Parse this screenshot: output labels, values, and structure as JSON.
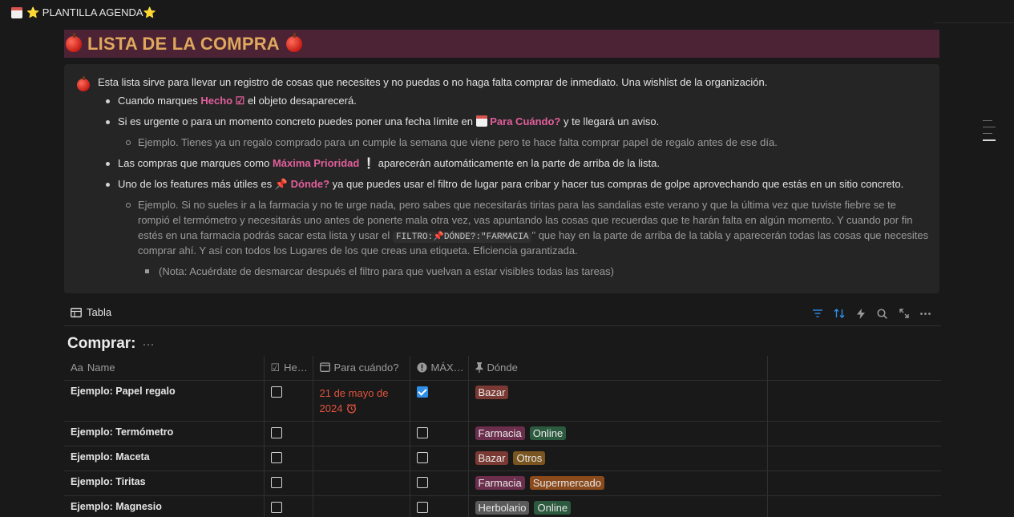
{
  "breadcrumb": {
    "title": "⭐️ PLANTILLA AGENDA⭐️"
  },
  "heading": {
    "title": "LISTA DE LA COMPRA"
  },
  "callout": {
    "intro": "Esta lista sirve para llevar un registro de cosas que necesites y no puedas o no haga falta comprar de inmediato. Una wishlist de la organización.",
    "b1_pre": "Cuando marques ",
    "b1_hl": "Hecho ☑",
    "b1_post": " el objeto desaparecerá.",
    "b2_pre": "Si es urgente o para un momento concreto puedes poner una fecha límite en ",
    "b2_hl": "Para Cuándo?",
    "b2_post": " y te llegará un aviso.",
    "b2_sub": "Ejemplo. Tienes ya un regalo comprado para un cumple la semana que viene pero te hace falta comprar papel de regalo antes de ese día.",
    "b3_pre": "Las compras que marques como ",
    "b3_hl": "Máxima Prioridad",
    "b3_emoji": "❕",
    "b3_post": " aparecerán automáticamente en la parte de arriba de la lista.",
    "b4_pre": "Uno de los features más útiles es ",
    "b4_hl": "Dónde?",
    "b4_post": " ya que puedes usar el filtro de lugar para cribar y hacer tus compras de golpe aprovechando que estás en un sitio concreto.",
    "b4_sub_l1": "Ejemplo. Si no sueles ir a la farmacia y no te urge nada, pero sabes que necesitarás tiritas para las sandalias este verano y que la última vez que tuviste fiebre se te",
    "b4_sub_l2": "rompió el termómetro y necesitarás uno antes de ponerte mala otra vez, vas apuntando las cosas que recuerdas que te harán falta en algún momento. Y cuando por fin",
    "b4_sub_l3_pre": "estés en una farmacia podrás sacar esta lista y usar el ",
    "b4_sub_l3_code": "FILTRO:📌DÓNDE?:\"FARMACIA",
    "b4_sub_l3_post": "\" que hay en la parte de arriba de la tabla y aparecerán todas las cosas que necesites",
    "b4_sub_l4": "comprar ahí. Y así con todos los Lugares de los que creas una etiqueta. Eficiencia garantizada.",
    "b4_note": "(Nota: Acuérdate de desmarcar después el filtro para que vuelvan a estar visibles todas las tareas)"
  },
  "database": {
    "view_label": "Tabla",
    "title": "Comprar:",
    "tools": [
      "filter-icon",
      "sort-icon",
      "automation-icon",
      "search-icon",
      "expand-icon",
      "more-icon"
    ],
    "columns": {
      "name": "Name",
      "done": "He…",
      "when": "Para cuándo?",
      "priority": "MÁX…",
      "where": "Dónde"
    },
    "rows": [
      {
        "name": "Ejemplo: Papel regalo",
        "done": false,
        "date_l1": "21 de mayo de",
        "date_l2": "2024",
        "priority": true,
        "tags": [
          "Bazar"
        ]
      },
      {
        "name": "Ejemplo: Termómetro",
        "done": false,
        "priority": false,
        "tags": [
          "Farmacia",
          "Online"
        ]
      },
      {
        "name": "Ejemplo: Maceta",
        "done": false,
        "priority": false,
        "tags": [
          "Bazar",
          "Otros"
        ]
      },
      {
        "name": "Ejemplo: Tiritas",
        "done": false,
        "priority": false,
        "tags": [
          "Farmacia",
          "Supermercado"
        ]
      },
      {
        "name": "Ejemplo: Magnesio",
        "done": false,
        "priority": false,
        "tags": [
          "Herbolario",
          "Online"
        ]
      }
    ],
    "tag_colors": {
      "Bazar": "#7a3a33",
      "Farmacia": "#6b2f4d",
      "Online": "#2c5a3f",
      "Otros": "#7a5520",
      "Supermercado": "#8a4a1c",
      "Herbolario": "#5a5a5a"
    }
  },
  "colors": {
    "accent_pink": "#e25f9c",
    "heading_bg": "#4b2334",
    "heading_text": "#e0a85c",
    "date_red": "#e0533f",
    "checkbox_blue": "#2e8fe8"
  }
}
